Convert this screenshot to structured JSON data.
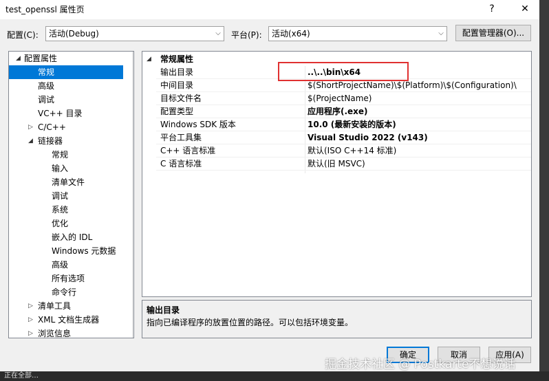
{
  "window": {
    "title": "test_openssl 属性页",
    "help_glyph": "?",
    "close_glyph": "✕"
  },
  "config_bar": {
    "config_label": "配置(C):",
    "config_value": "活动(Debug)",
    "platform_label": "平台(P):",
    "platform_value": "活动(x64)",
    "manager_button": "配置管理器(O)..."
  },
  "tree": {
    "items": [
      {
        "label": "配置属性",
        "expander": "◢"
      },
      {
        "label": "常规"
      },
      {
        "label": "高级"
      },
      {
        "label": "调试"
      },
      {
        "label": "VC++ 目录"
      },
      {
        "label": "C/C++",
        "expander": "▷"
      },
      {
        "label": "链接器",
        "expander": "◢"
      },
      {
        "label": "常规"
      },
      {
        "label": "输入"
      },
      {
        "label": "清单文件"
      },
      {
        "label": "调试"
      },
      {
        "label": "系统"
      },
      {
        "label": "优化"
      },
      {
        "label": "嵌入的 IDL"
      },
      {
        "label": "Windows 元数据"
      },
      {
        "label": "高级"
      },
      {
        "label": "所有选项"
      },
      {
        "label": "命令行"
      },
      {
        "label": "清单工具",
        "expander": "▷"
      },
      {
        "label": "XML 文档生成器",
        "expander": "▷"
      },
      {
        "label": "浏览信息",
        "expander": "▷"
      }
    ]
  },
  "grid": {
    "category": "常规属性",
    "category_expander": "◢",
    "rows": [
      {
        "name": "输出目录",
        "value": "..\\..\\bin\\x64"
      },
      {
        "name": "中间目录",
        "value": "$(ShortProjectName)\\$(Platform)\\$(Configuration)\\"
      },
      {
        "name": "目标文件名",
        "value": "$(ProjectName)"
      },
      {
        "name": "配置类型",
        "value": "应用程序(.exe)"
      },
      {
        "name": "Windows SDK 版本",
        "value": "10.0 (最新安装的版本)"
      },
      {
        "name": "平台工具集",
        "value": "Visual Studio 2022 (v143)"
      },
      {
        "name": "C++ 语言标准",
        "value": "默认(ISO C++14 标准)"
      },
      {
        "name": "C 语言标准",
        "value": "默认(旧 MSVC)"
      }
    ]
  },
  "description": {
    "title": "输出目录",
    "text": "指向已编译程序的放置位置的路径。可以包括环境变量。"
  },
  "buttons": {
    "ok": "确定",
    "cancel": "取消",
    "apply": "应用(A)"
  },
  "scroll": {
    "up": "▲",
    "down": "▼"
  },
  "combo_arrow": "⌵",
  "bottom_text": "正在全部…",
  "watermark": "掘金技术社区 @ Postkarte不想说话"
}
